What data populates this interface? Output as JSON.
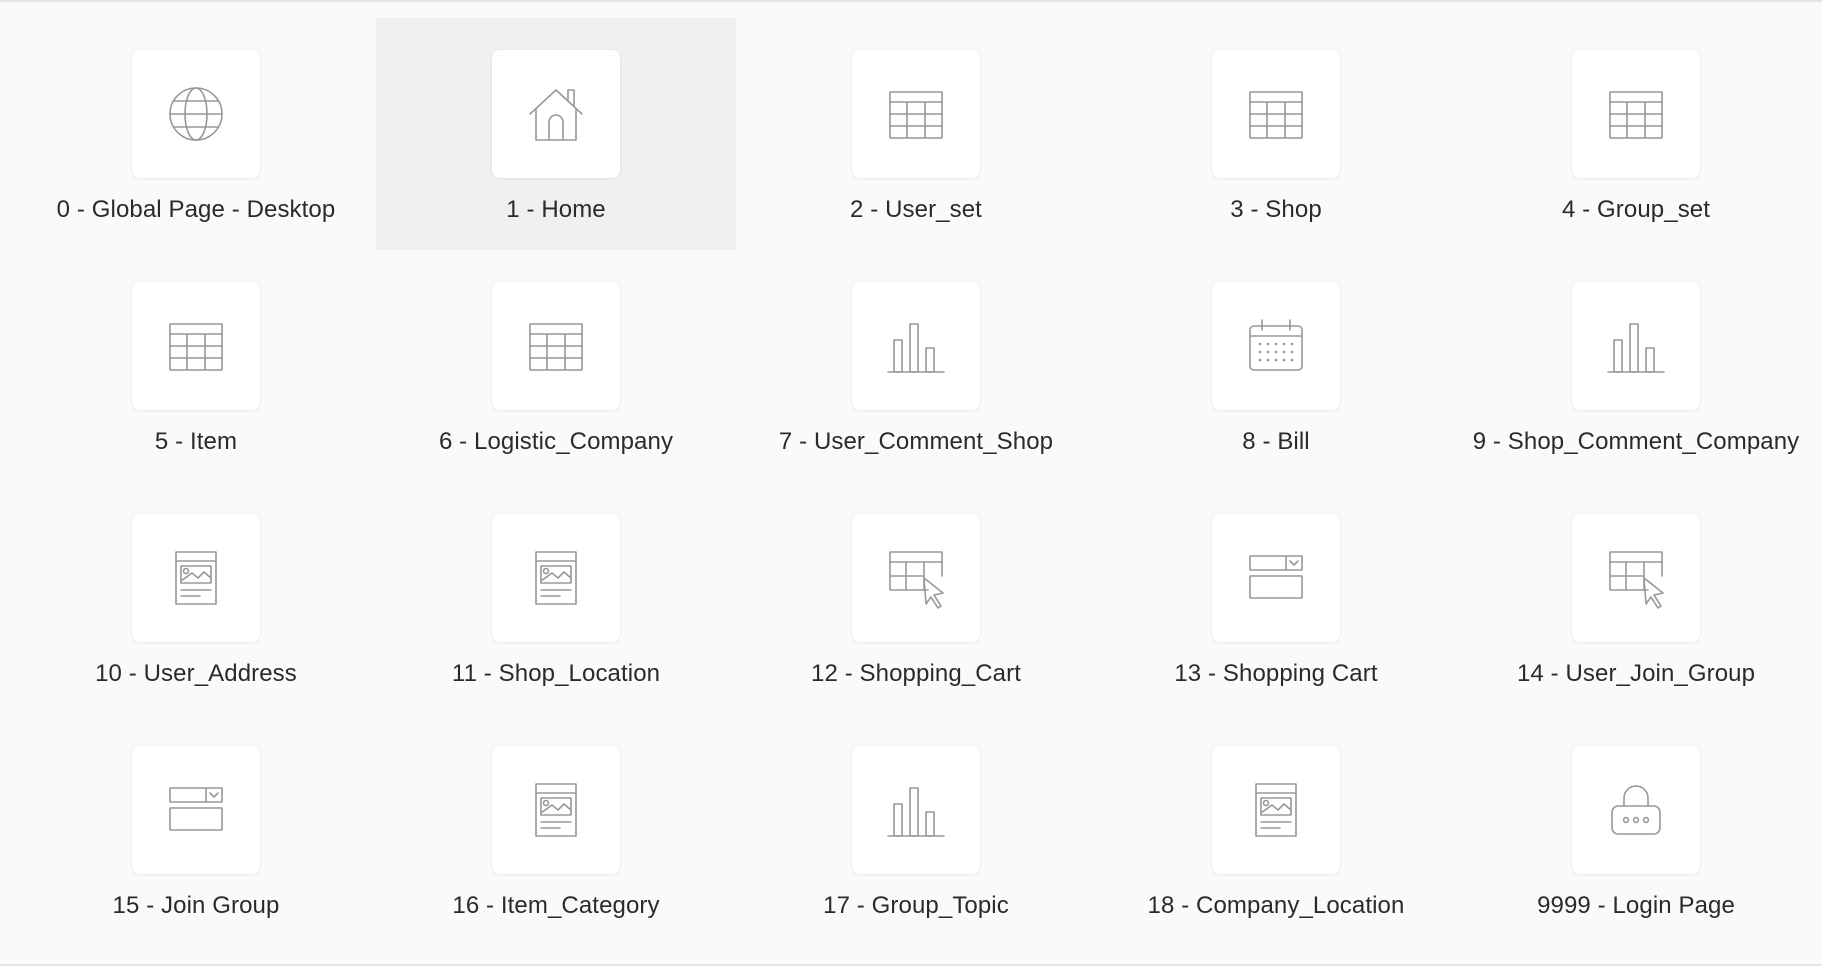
{
  "colors": {
    "background": "#fbfaf9",
    "icon_stroke": "#9a9896",
    "text": "#2c2a28",
    "selected_tile": "#f1f0ef"
  },
  "pages": [
    {
      "label": "0 - Global Page - Desktop",
      "icon": "globe-icon"
    },
    {
      "label": "1 - Home",
      "icon": "home-icon",
      "selected": true
    },
    {
      "label": "2 - User_set",
      "icon": "table-icon"
    },
    {
      "label": "3 - Shop",
      "icon": "table-icon"
    },
    {
      "label": "4 - Group_set",
      "icon": "table-icon"
    },
    {
      "label": "5 - Item",
      "icon": "table-icon"
    },
    {
      "label": "6 - Logistic_Company",
      "icon": "table-icon"
    },
    {
      "label": "7 - User_Comment_Shop",
      "icon": "bar-chart-icon"
    },
    {
      "label": "8 - Bill",
      "icon": "calendar-icon"
    },
    {
      "label": "9 - Shop_Comment_Company",
      "icon": "bar-chart-icon"
    },
    {
      "label": "10 - User_Address",
      "icon": "form-icon"
    },
    {
      "label": "11 - Shop_Location",
      "icon": "form-icon"
    },
    {
      "label": "12 - Shopping_Cart",
      "icon": "interactive-grid-icon"
    },
    {
      "label": "13 - Shopping Cart",
      "icon": "modal-form-icon"
    },
    {
      "label": "14 - User_Join_Group",
      "icon": "interactive-grid-icon"
    },
    {
      "label": "15 - Join Group",
      "icon": "modal-form-icon"
    },
    {
      "label": "16 - Item_Category",
      "icon": "form-icon"
    },
    {
      "label": "17 - Group_Topic",
      "icon": "bar-chart-icon"
    },
    {
      "label": "18 - Company_Location",
      "icon": "form-icon"
    },
    {
      "label": "9999 - Login Page",
      "icon": "lock-icon"
    }
  ]
}
